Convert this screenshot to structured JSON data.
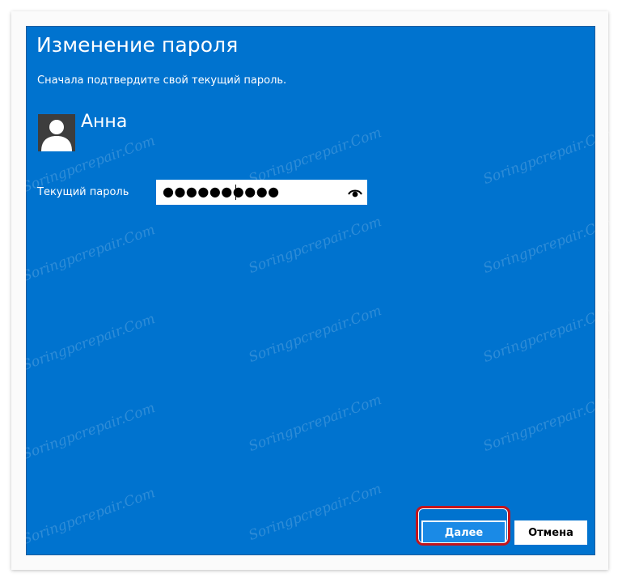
{
  "dialog": {
    "title": "Изменение пароля",
    "subtitle": "Сначала подтвердите свой текущий пароль.",
    "user": {
      "name": "Анна",
      "avatar_icon": "user-silhouette-icon"
    },
    "current_password": {
      "label": "Текущий пароль",
      "value": "●●●●●●●●●●",
      "reveal_icon": "eye-icon"
    },
    "buttons": {
      "next_label": "Далее",
      "cancel_label": "Отмена"
    }
  },
  "watermark": "Soringpcrepair.Com",
  "colors": {
    "dialog_background": "#0073cf",
    "primary_button": "#1a8ae6",
    "highlight": "#c3151c",
    "avatar_background": "#3d3d3d"
  }
}
